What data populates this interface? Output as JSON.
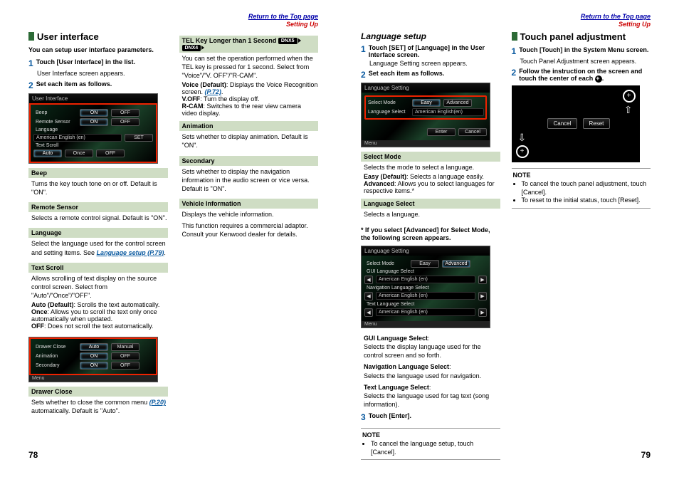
{
  "page_left": "78",
  "page_right": "79",
  "top": {
    "return": "Return to the Top page",
    "setup": "Setting Up"
  },
  "badges": {
    "dnx5": "DNX5",
    "dnx4": "DNX4"
  },
  "ui": {
    "title": "User interface",
    "intro": "You can setup user interface parameters.",
    "step1": "Touch [User Interface] in the list.",
    "step1_desc": "User Interface screen appears.",
    "step2": "Set each item as follows.",
    "dev1": {
      "title": "User Interface",
      "beep": "Beep",
      "on": "ON",
      "off": "OFF",
      "remote": "Remote Sensor",
      "lang": "Language",
      "lang_val": "American English (en)",
      "set": "SET",
      "text": "Text Scroll",
      "auto": "Auto",
      "once": "Once"
    },
    "beep_h": "Beep",
    "beep_d": "Turns the key touch tone on or off. Default is \"ON\".",
    "remote_h": "Remote Sensor",
    "remote_d": "Selects a remote control signal. Default is \"ON\".",
    "lang_h": "Language",
    "lang_d1": "Select the language used for the control screen and setting items. See ",
    "lang_link": "Language setup (P.79)",
    "lang_d2": ".",
    "text_h": "Text Scroll",
    "text_d": "Allows scrolling of text display on the source control screen. Select from \"Auto\"/\"Once\"/\"OFF\".",
    "text_auto": "Auto (Default)",
    "text_auto_d": ": Scrolls the text automatically.",
    "text_once": "Once",
    "text_once_d": ": Allows you to scroll the text only once automatically when updated.",
    "text_off": "OFF",
    "text_off_d": ": Does not scroll the text automatically.",
    "dev2": {
      "drawer": "Drawer Close",
      "auto": "Auto",
      "manual": "Manual",
      "anim": "Animation",
      "on": "ON",
      "off": "OFF",
      "sec": "Secondary",
      "menu": "Menu"
    },
    "drawer_h": "Drawer Close",
    "drawer_d1": "Sets whether to close the common menu ",
    "drawer_link": "(P.20)",
    "drawer_d2": " automatically. Default is \"Auto\"."
  },
  "ui2": {
    "tel_h": "TEL Key Longer than 1 Second",
    "tel_d": "You can set the operation performed when the TEL key is pressed for 1 second. Select from \"Voice\"/\"V. OFF\"/\"R-CAM\".",
    "voice": "Voice (Default)",
    "voice_d": ": Displays the Voice Recognition screen. ",
    "voice_link": "(P.72)",
    "voff": "V.OFF",
    "voff_d": ": Turn the display off.",
    "rcam": "R-CAM",
    "rcam_d": ": Switches to the rear view camera video display.",
    "anim_h": "Animation",
    "anim_d": "Sets whether to display animation. Default is \"ON\".",
    "sec_h": "Secondary",
    "sec_d": "Sets whether to display the navigation information in the audio screen or vice versa. Default is \"ON\".",
    "vi_h": "Vehicle Information",
    "vi_d1": "Displays the vehicle information.",
    "vi_d2": "This function requires a commercial adaptor. Consult your Kenwood dealer for details."
  },
  "lang": {
    "title": "Language setup",
    "step1": "Touch [SET] of [Language] in the User Interface screen.",
    "step1_desc": "Language Setting screen appears.",
    "step2": "Set each item as follows.",
    "dev1": {
      "title": "Language Setting",
      "mode": "Select Mode",
      "easy": "Easy",
      "adv": "Advanced",
      "lsel": "Language Select",
      "val": "American English(en)",
      "enter": "Enter",
      "cancel": "Cancel",
      "menu": "Menu"
    },
    "mode_h": "Select Mode",
    "mode_d": "Selects the mode to select a language.",
    "mode_easy": "Easy (Default)",
    "mode_easy_d": ": Selects a language easily.",
    "mode_adv": "Advanced",
    "mode_adv_d": ": Allows you to select languages for respective items.*",
    "lsel_h": "Language Select",
    "lsel_d": "Selects a language.",
    "adv_intro": "* If you select [Advanced] for Select Mode, the following screen appears.",
    "dev2": {
      "title": "Language Setting",
      "mode": "Select Mode",
      "easy": "Easy",
      "adv": "Advanced",
      "gui": "GUI Language Select",
      "gui_val": "American English (en)",
      "nav": "Navigation Language Select",
      "nav_val": "American English (en)",
      "txt": "Text Language Select",
      "txt_val": "American English (en)",
      "menu": "Menu"
    },
    "gui_h": "GUI Language Select",
    "gui_d": "Selects the display language used for the control screen and so forth.",
    "nav_h": "Navigation Language Select",
    "nav_d": "Selects the language used for navigation.",
    "txt_h": "Text Language Select",
    "txt_d": "Selects the language used for tag text (song information).",
    "step3": "Touch [Enter].",
    "note_title": "NOTE",
    "note1": "To cancel the language setup, touch [Cancel]."
  },
  "touch": {
    "title": "Touch panel adjustment",
    "step1": "Touch [Touch] in the System Menu screen.",
    "step1_desc": "Touch Panel Adjustment screen appears.",
    "step2a": "Follow the instruction on the screen and touch the center of each ",
    "step2b": ".",
    "cancel": "Cancel",
    "reset": "Reset",
    "note_title": "NOTE",
    "note1": "To cancel the touch panel adjustment, touch [Cancel].",
    "note2": "To reset to the initial status, touch [Reset]."
  }
}
